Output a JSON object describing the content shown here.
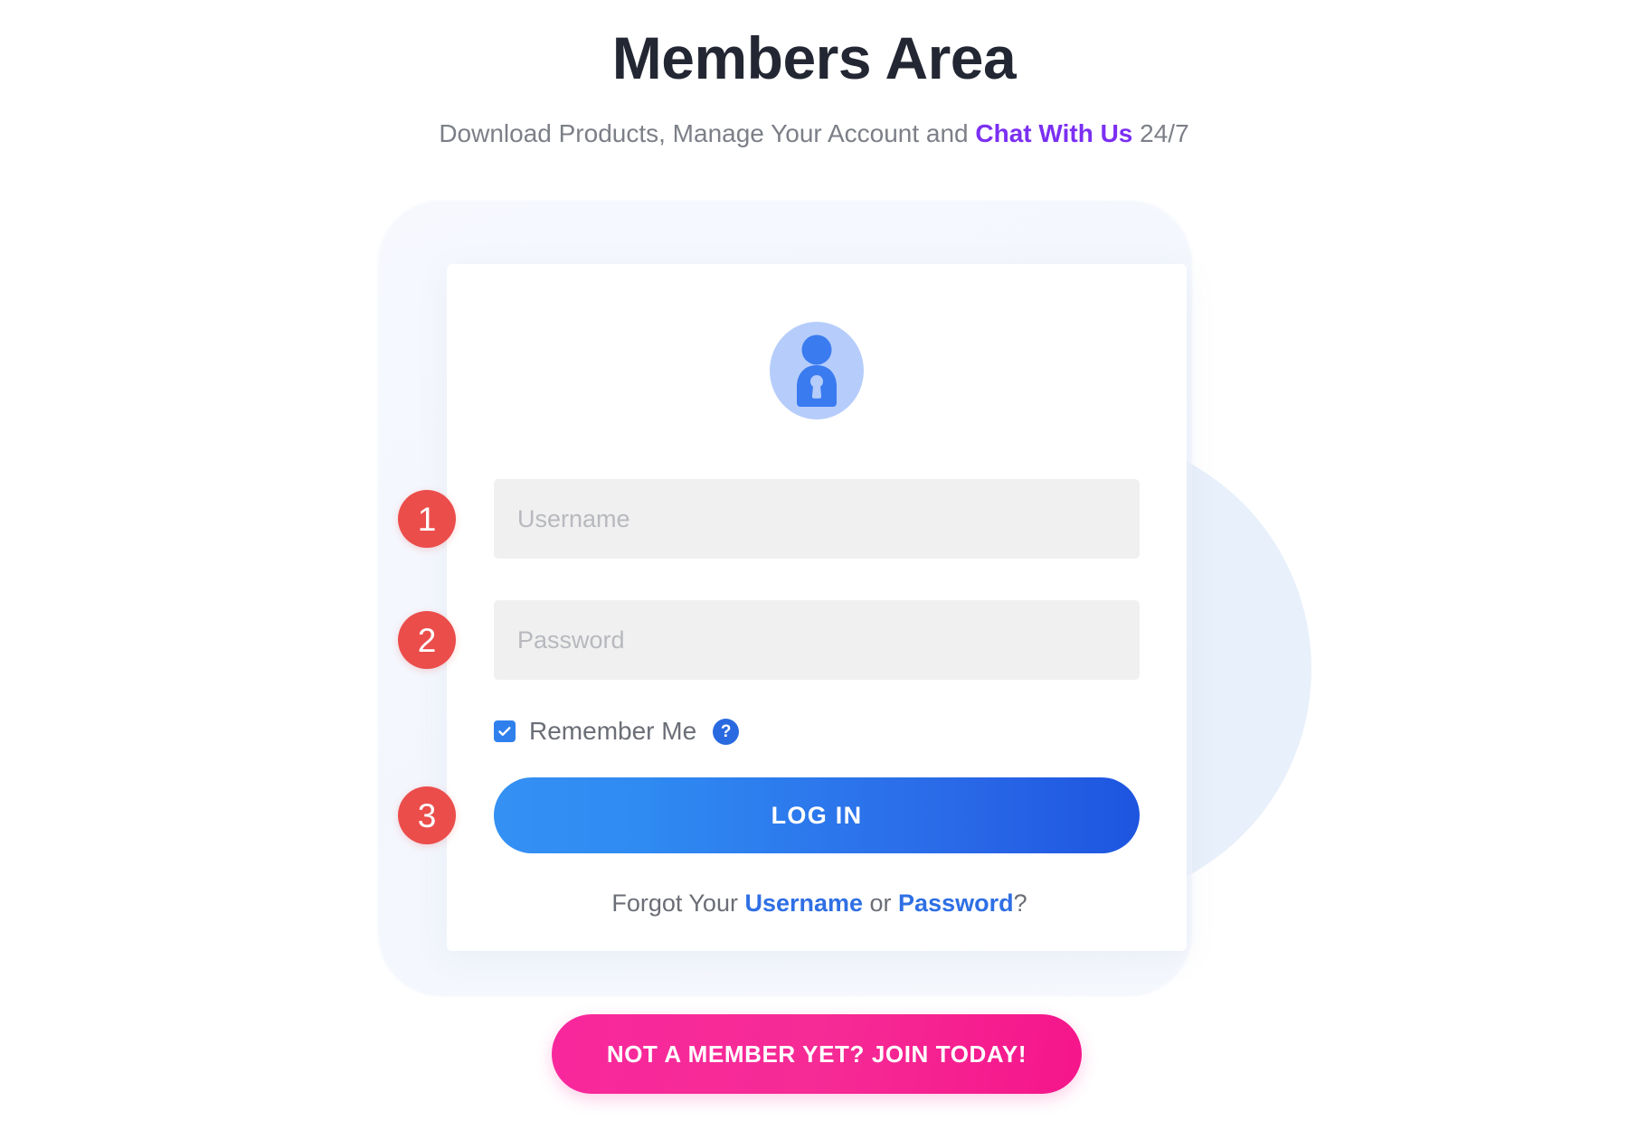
{
  "header": {
    "title": "Members Area",
    "subtitle_prefix": "Download Products, Manage Your Account and ",
    "chat_link": "Chat With Us",
    "subtitle_suffix": " 24/7"
  },
  "card": {
    "avatar_icon": "user-lock-icon",
    "steps": {
      "username": "1",
      "password": "2",
      "login": "3"
    },
    "username_field": {
      "placeholder": "Username",
      "value": ""
    },
    "password_field": {
      "placeholder": "Password",
      "value": ""
    },
    "remember": {
      "label": "Remember Me",
      "checked": true,
      "help_icon": "question-mark-icon",
      "help_label": "?"
    },
    "login_button": "LOG IN",
    "forgot": {
      "prefix": "Forgot Your ",
      "username_link": "Username",
      "middle": " or ",
      "password_link": "Password",
      "suffix": "?"
    }
  },
  "cta": {
    "join_button": "NOT A MEMBER YET? JOIN TODAY!"
  },
  "colors": {
    "title": "#232733",
    "subtitle": "#7c7f87",
    "chat_link": "#7b2ff2",
    "step_badge": "#eb4d4b",
    "input_bg": "#f0f0f0",
    "placeholder": "#b7b9be",
    "login_gradient_start": "#3490f3",
    "login_gradient_end": "#1d55e0",
    "forgot_link": "#2f6fe4",
    "checkbox": "#2f80ed",
    "help_icon": "#2a6ae0",
    "join_button": "#f6289a",
    "avatar_bg": "#b6cdfb",
    "avatar_fg": "#3a7bf0",
    "card_bg": "#ffffff",
    "panel_bg": "#f4f7fd",
    "blob_bg": "#e7effb"
  }
}
